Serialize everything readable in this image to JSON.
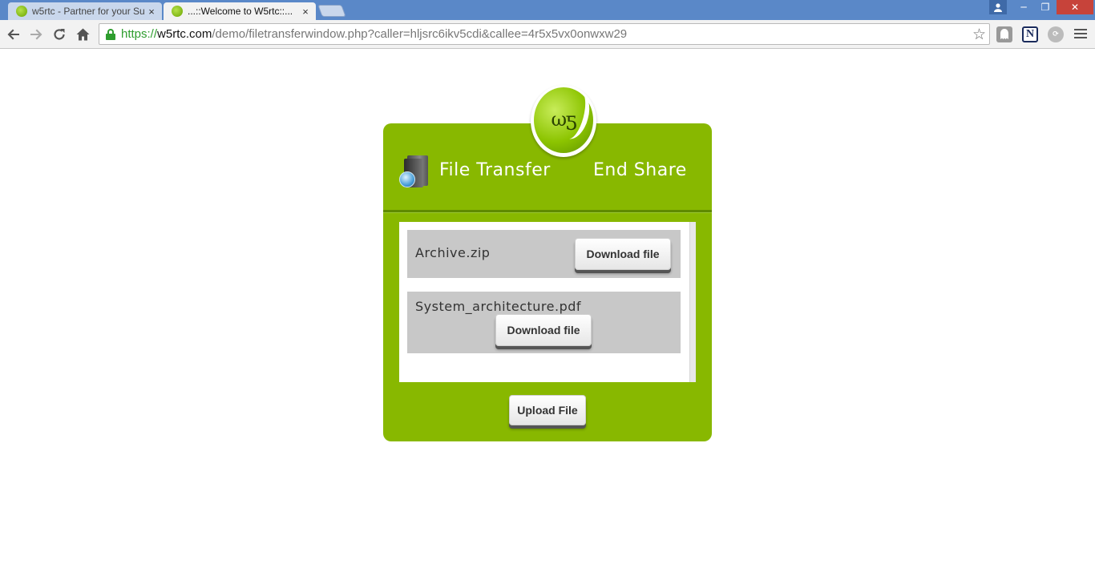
{
  "browser": {
    "tabs": [
      {
        "title": "w5rtc - Partner for your Su",
        "close": "×"
      },
      {
        "title": "...::Welcome to W5rtc::...",
        "close": "×"
      }
    ],
    "url": {
      "scheme": "https://",
      "host": "w5rtc.com",
      "rest": "/demo/filetransferwindow.php?caller=hljsrc6ikv5cdi&callee=4r5x5vx0onwxw29"
    },
    "nav_icons": [
      "back-icon",
      "forward-icon",
      "reload-icon",
      "home-icon"
    ],
    "window_controls": {
      "minimize": "─",
      "maximize": "❐",
      "close": "✕"
    },
    "extensions": [
      {
        "name": "ghostery-icon",
        "glyph": ""
      },
      {
        "name": "n-extension-icon",
        "glyph": "N"
      },
      {
        "name": "sync-extension-icon",
        "glyph": "⟳"
      }
    ],
    "colors": {
      "titlebar": "#5a88c8",
      "secure": "#2e9d2e"
    }
  },
  "page": {
    "logo_text": "ωƽ",
    "header": {
      "file_transfer": "File Transfer",
      "end_share": "End Share"
    },
    "files": [
      {
        "name": "Archive.zip",
        "action": "Download file"
      },
      {
        "name": "System_architecture.pdf",
        "action": "Download file"
      }
    ],
    "upload_label": "Upload File",
    "colors": {
      "panel": "#88b800",
      "row": "#c8c8c8"
    }
  }
}
